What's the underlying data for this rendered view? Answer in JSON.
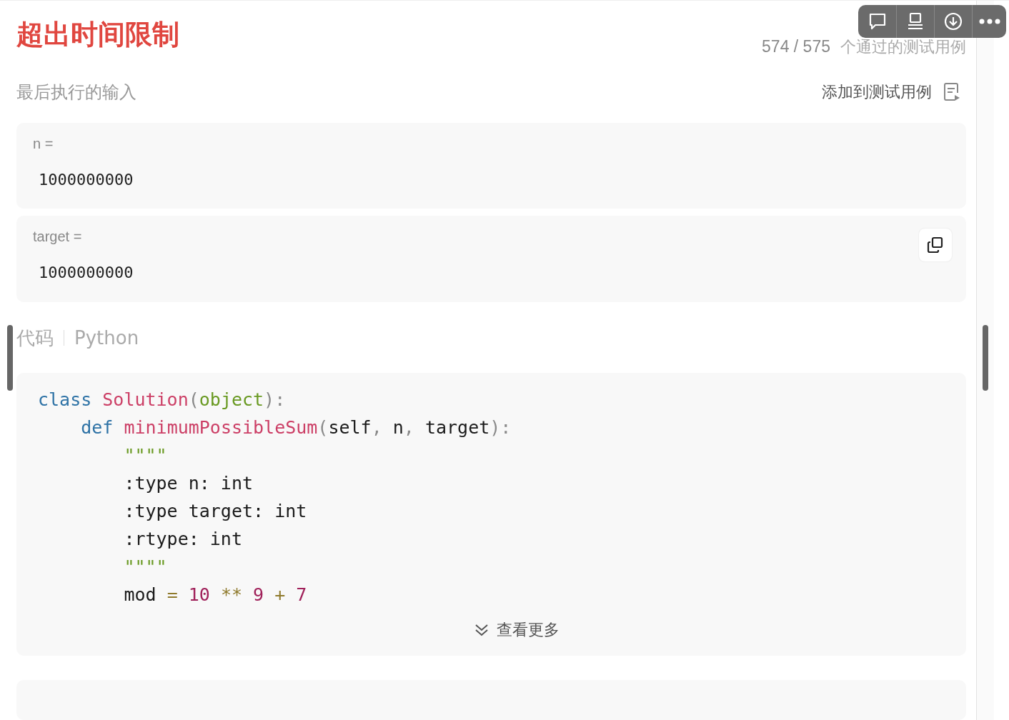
{
  "result": {
    "title": "超出时间限制",
    "passed": "574 / 575",
    "passed_label": "个通过的测试用例"
  },
  "toolbar": {
    "buttons": [
      {
        "kind": "comment"
      },
      {
        "kind": "screen"
      },
      {
        "kind": "download"
      },
      {
        "kind": "more"
      }
    ]
  },
  "last_input": {
    "title": "最后执行的输入",
    "add_button": "添加到测试用例",
    "params": [
      {
        "name": "n =",
        "value": "1000000000",
        "copy": false
      },
      {
        "name": "target =",
        "value": "1000000000",
        "copy": true
      }
    ]
  },
  "code": {
    "title": "代码",
    "language": "Python",
    "more": "查看更多",
    "lines": [
      [
        {
          "kind": "keyword",
          "text": "class "
        },
        {
          "kind": "name",
          "text": "Solution"
        },
        {
          "kind": "punct",
          "text": "("
        },
        {
          "kind": "builtin",
          "text": "object"
        },
        {
          "kind": "punct",
          "text": "):"
        }
      ],
      [
        {
          "kind": "keyword",
          "text": "    def "
        },
        {
          "kind": "name",
          "text": "minimumPossibleSum"
        },
        {
          "kind": "punct",
          "text": "("
        },
        {
          "kind": "plain",
          "text": "self"
        },
        {
          "kind": "punct",
          "text": ", "
        },
        {
          "kind": "plain",
          "text": "n"
        },
        {
          "kind": "punct",
          "text": ", "
        },
        {
          "kind": "plain",
          "text": "target"
        },
        {
          "kind": "punct",
          "text": "):"
        }
      ],
      [
        {
          "kind": "string",
          "text": "        \"\"\"\""
        }
      ],
      [
        {
          "kind": "plain",
          "text": "        :type n: int"
        }
      ],
      [
        {
          "kind": "plain",
          "text": "        :type target: int"
        }
      ],
      [
        {
          "kind": "plain",
          "text": "        :rtype: int"
        }
      ],
      [
        {
          "kind": "string",
          "text": "        \"\"\"\""
        }
      ],
      [
        {
          "kind": "plain",
          "text": "        mod "
        },
        {
          "kind": "op",
          "text": "= "
        },
        {
          "kind": "number",
          "text": "10 "
        },
        {
          "kind": "op",
          "text": "** "
        },
        {
          "kind": "number",
          "text": "9 "
        },
        {
          "kind": "op",
          "text": "+ "
        },
        {
          "kind": "number",
          "text": "7"
        }
      ]
    ]
  }
}
